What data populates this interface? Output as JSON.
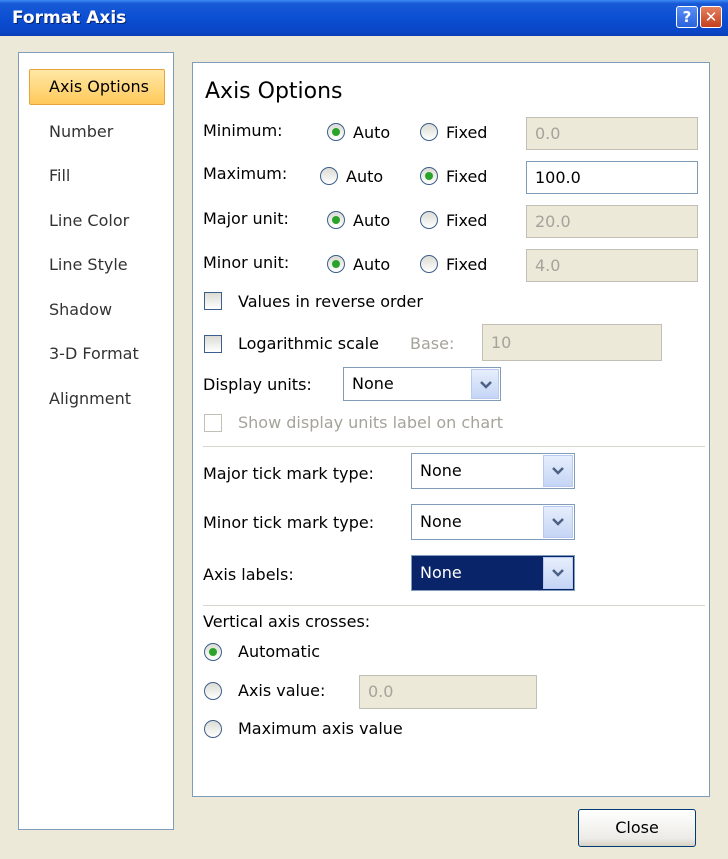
{
  "window": {
    "title": "Format Axis",
    "help_glyph": "?",
    "close_glyph": "✕"
  },
  "sidebar": {
    "items": [
      {
        "label": "Axis Options",
        "selected": true
      },
      {
        "label": "Number"
      },
      {
        "label": "Fill"
      },
      {
        "label": "Line Color"
      },
      {
        "label": "Line Style"
      },
      {
        "label": "Shadow"
      },
      {
        "label": "3-D Format"
      },
      {
        "label": "Alignment"
      }
    ]
  },
  "main": {
    "title": "Axis Options",
    "auto_label": "Auto",
    "fixed_label": "Fixed",
    "rows": [
      {
        "label": "Minimum:",
        "selected": "auto",
        "value": "0.0",
        "enabled": false
      },
      {
        "label": "Maximum:",
        "selected": "fixed",
        "value": "100.0",
        "enabled": true
      },
      {
        "label": "Major unit:",
        "selected": "auto",
        "value": "20.0",
        "enabled": false
      },
      {
        "label": "Minor unit:",
        "selected": "auto",
        "value": "4.0",
        "enabled": false
      }
    ],
    "reverse_order_label": "Values in reverse order",
    "log_scale_label": "Logarithmic scale",
    "base_label": "Base:",
    "base_value": "10",
    "display_units_label": "Display units:",
    "display_units_value": "None",
    "show_units_label": "Show display units label on chart",
    "major_tick_label": "Major tick mark type:",
    "major_tick_value": "None",
    "minor_tick_label": "Minor tick mark type:",
    "minor_tick_value": "None",
    "axis_labels_label": "Axis labels:",
    "axis_labels_value": "None",
    "crosses_label": "Vertical axis crosses:",
    "automatic_label": "Automatic",
    "axis_value_label": "Axis value:",
    "axis_value": "0.0",
    "max_axis_value_label": "Maximum axis value",
    "crosses_selected": "automatic"
  },
  "footer": {
    "close_label": "Close"
  },
  "colors": {
    "titlebar": "#0a4fd3",
    "selected_nav": "#ffc95a",
    "radio_dot": "#2aa32a",
    "combo_highlight": "#0a246a"
  }
}
